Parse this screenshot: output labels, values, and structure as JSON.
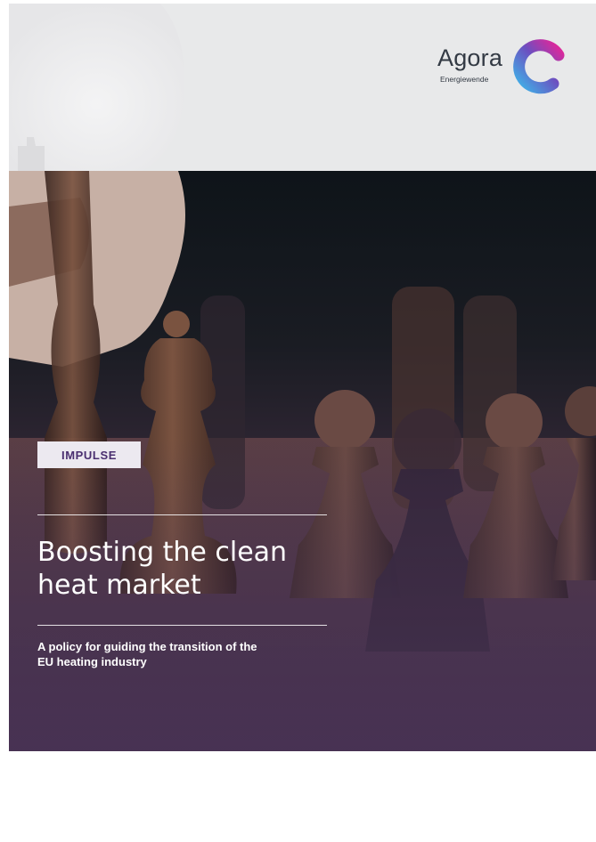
{
  "brand": {
    "name": "Agora",
    "sub": "Energiewende",
    "colors": {
      "gradient_start": "#3fb2e8",
      "gradient_mid": "#6c4fc0",
      "gradient_end": "#e1279a"
    }
  },
  "cover": {
    "badge": "IMPULSE",
    "title_line1": "Boosting the clean",
    "title_line2": "heat market",
    "subtitle_line1": "A policy for guiding the transition of the",
    "subtitle_line2": "EU heating industry",
    "image": "chess-pieces-photo"
  },
  "colors": {
    "header_band": "#e8e9ea",
    "badge_bg": "#ece9f0",
    "badge_text": "#4a2f70",
    "overlay_purple": "#4b3556"
  }
}
